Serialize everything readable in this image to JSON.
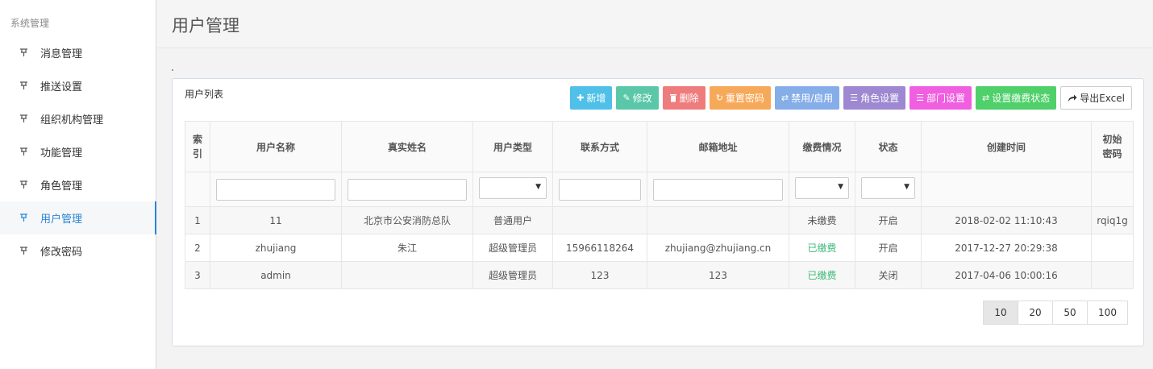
{
  "sidebar": {
    "title": "系统管理",
    "items": [
      {
        "label": "消息管理",
        "icon": "pin-icon"
      },
      {
        "label": "推送设置",
        "icon": "pin-icon"
      },
      {
        "label": "组织机构管理",
        "icon": "pin-icon"
      },
      {
        "label": "功能管理",
        "icon": "pin-icon"
      },
      {
        "label": "角色管理",
        "icon": "pin-icon"
      },
      {
        "label": "用户管理",
        "icon": "pin-icon",
        "active": true
      },
      {
        "label": "修改密码",
        "icon": "pin-icon"
      }
    ]
  },
  "header": {
    "title": "用户管理"
  },
  "panel": {
    "title": "用户列表"
  },
  "toolbar": {
    "add": "新增",
    "edit": "修改",
    "delete": "删除",
    "reset_password": "重置密码",
    "toggle": "禁用/启用",
    "role": "角色设置",
    "dept": "部门设置",
    "fee_status": "设置缴费状态",
    "export": "导出Excel"
  },
  "table": {
    "columns": [
      "索引",
      "用户名称",
      "真实姓名",
      "用户类型",
      "联系方式",
      "邮箱地址",
      "缴费情况",
      "状态",
      "创建时间",
      "初始密码"
    ],
    "rows": [
      [
        "1",
        "11",
        "北京市公安消防总队",
        "普通用户",
        "",
        "",
        "未缴费",
        "开启",
        "2018-02-02 11:10:43",
        "rqiq1g"
      ],
      [
        "2",
        "zhujiang",
        "朱江",
        "超级管理员",
        "15966118264",
        "zhujiang@zhujiang.cn",
        "已缴费",
        "开启",
        "2017-12-27 20:29:38",
        ""
      ],
      [
        "3",
        "admin",
        "",
        "超级管理员",
        "123",
        "123",
        "已缴费",
        "关闭",
        "2017-04-06 10:00:16",
        ""
      ]
    ]
  },
  "pager": {
    "sizes": [
      "10",
      "20",
      "50",
      "100"
    ],
    "selected": "10"
  },
  "colors": {
    "accent": "#2a86d4",
    "paid": "#3cb878"
  }
}
